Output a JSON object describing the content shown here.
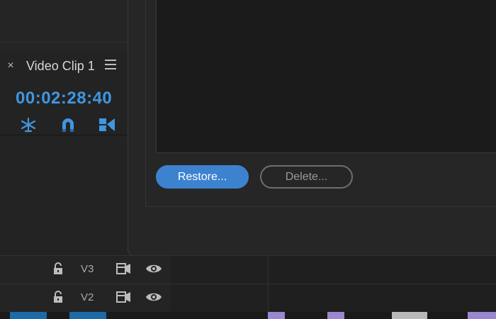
{
  "timeline_panel": {
    "tab_close_glyph": "×",
    "tab_title": "Video Clip 1",
    "timecode": "00:02:28:40",
    "accent_color": "#3f97e0",
    "tools": [
      "snap-icon",
      "magnet-icon",
      "linked-selection-icon"
    ]
  },
  "dialog": {
    "restore_label": "Restore...",
    "delete_label": "Delete...",
    "primary_color": "#3d82cf"
  },
  "tracks": [
    {
      "name": "V3"
    },
    {
      "name": "V2"
    }
  ]
}
